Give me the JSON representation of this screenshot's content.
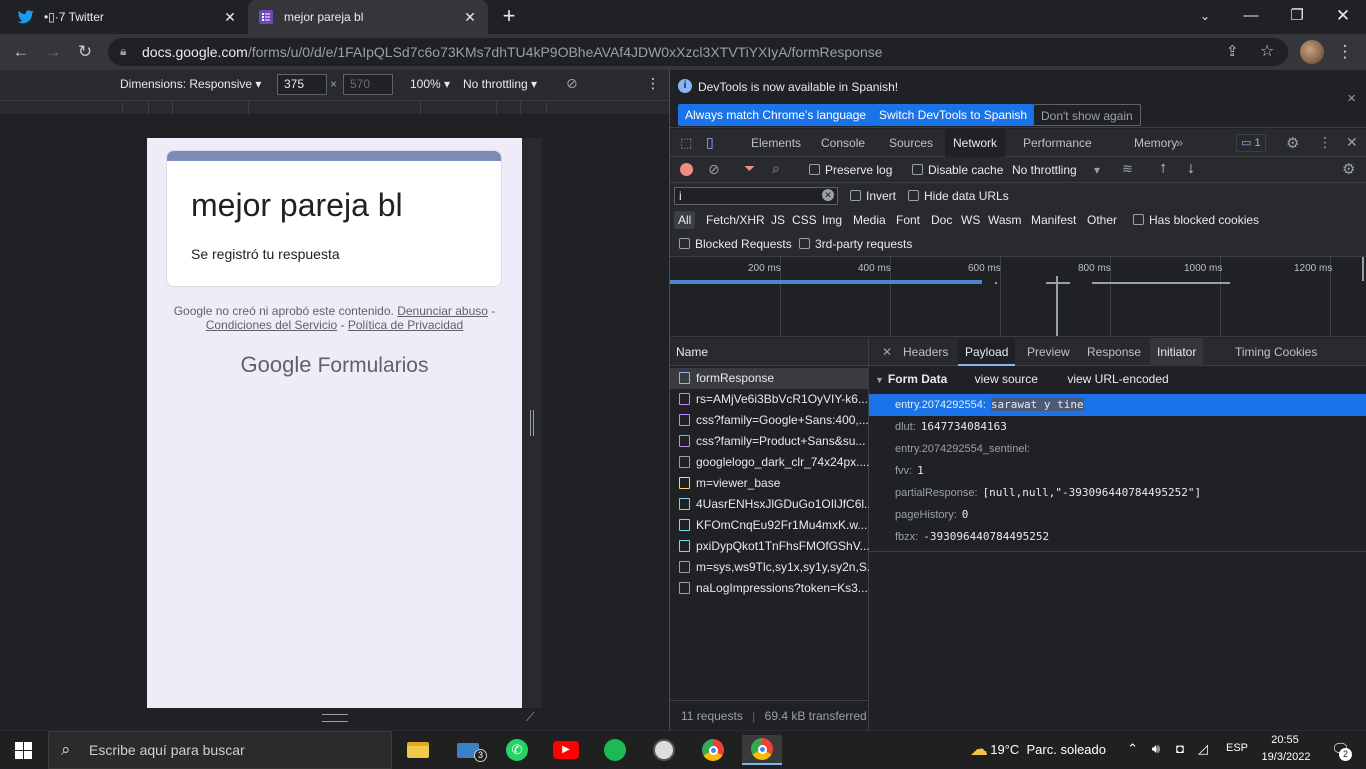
{
  "browser": {
    "tabs": [
      {
        "title": "•⁠▯⁠·⁠7 Twitter",
        "icon": "twitter-icon"
      },
      {
        "title": "mejor pareja bl",
        "icon": "google-forms-icon"
      }
    ],
    "url_host": "docs.google.com",
    "url_path": "/forms/u/0/d/e/1FAIpQLSd7c6o73KMs7dhTU4kP9OBheAVAf4JDW0xXzcl3XTVTiYXIyA/formResponse"
  },
  "device_toolbar": {
    "dimensions": "Dimensions: Responsive",
    "width": "375",
    "height": "570",
    "zoom": "100%",
    "throttling": "No throttling"
  },
  "form_page": {
    "title": "mejor pareja bl",
    "message": "Se registró tu respuesta",
    "disclaimer_text": "Google no creó ni aprobó este contenido.",
    "report_link": "Denunciar abuso",
    "terms_link": "Condiciones del Servicio",
    "privacy_link": "Política de Privacidad",
    "brand_google": "Google",
    "brand_product": "Formularios"
  },
  "devtools": {
    "infobar": {
      "message": "DevTools is now available in Spanish!",
      "btn_match": "Always match Chrome's language",
      "btn_switch": "Switch DevTools to Spanish",
      "btn_dismiss": "Don't show again"
    },
    "tabs": [
      "Elements",
      "Console",
      "Sources",
      "Network",
      "Performance",
      "Memory"
    ],
    "issues_count": "1",
    "network_bar": {
      "preserve_log": "Preserve log",
      "disable_cache": "Disable cache",
      "throttling": "No throttling"
    },
    "filter": {
      "value": "i",
      "invert": "Invert",
      "hide_data_urls": "Hide data URLs",
      "types": [
        "All",
        "Fetch/XHR",
        "JS",
        "CSS",
        "Img",
        "Media",
        "Font",
        "Doc",
        "WS",
        "Wasm",
        "Manifest",
        "Other"
      ],
      "has_blocked_cookies": "Has blocked cookies",
      "blocked_requests": "Blocked Requests",
      "third_party": "3rd-party requests"
    },
    "timeline_labels": [
      "200 ms",
      "400 ms",
      "600 ms",
      "800 ms",
      "1000 ms",
      "1200 ms"
    ],
    "requests_header": "Name",
    "requests": [
      {
        "name": "formResponse",
        "color": "#8ab4f8"
      },
      {
        "name": "rs=AMjVe6i3BbVcR1OyVIY-k6...",
        "color": "#c58af9"
      },
      {
        "name": "css?family=Google+Sans:400,...",
        "color": "#c58af9"
      },
      {
        "name": "css?family=Product+Sans&su...",
        "color": "#c58af9"
      },
      {
        "name": "googlelogo_dark_clr_74x24px....",
        "color": "#9aa0a6"
      },
      {
        "name": "m=viewer_base",
        "color": "#fdd663"
      },
      {
        "name": "4UasrENHsxJlGDuGo1OIlJfC6l...",
        "color": "#78d9ec"
      },
      {
        "name": "KFOmCnqEu92Fr1Mu4mxK.w...",
        "color": "#78d9ec"
      },
      {
        "name": "pxiDypQkot1TnFhsFMOfGShV...",
        "color": "#78d9ec"
      },
      {
        "name": "m=sys,ws9Tlc,sy1x,sy1y,sy2n,S...",
        "color": "#9aa0a6"
      },
      {
        "name": "naLogImpressions?token=Ks3...",
        "color": "#9aa0a6"
      }
    ],
    "requests_footer_count": "11 requests",
    "requests_footer_transfer": "69.4 kB transferred",
    "detail_tabs": [
      "Headers",
      "Payload",
      "Preview",
      "Response",
      "Initiator",
      "Timing",
      "Cookies"
    ],
    "form_data_label": "Form Data",
    "view_source": "view source",
    "view_url_encoded": "view URL-encoded",
    "form_data": [
      {
        "key": "entry.2074292554:",
        "value": "sarawat y tine"
      },
      {
        "key": "dlut:",
        "value": "1647734084163"
      },
      {
        "key": "entry.2074292554_sentinel:",
        "value": ""
      },
      {
        "key": "fvv:",
        "value": "1"
      },
      {
        "key": "partialResponse:",
        "value": "[null,null,\"-393096440784495252\"]"
      },
      {
        "key": "pageHistory:",
        "value": "0"
      },
      {
        "key": "fbzx:",
        "value": "-393096440784495252"
      }
    ]
  },
  "taskbar": {
    "search_placeholder": "Escribe aquí para buscar",
    "mail_badge": "3",
    "weather": "19°C  Parc. soleado",
    "lang": "ESP",
    "time": "20:55",
    "date": "19/3/2022",
    "notifications": "2"
  }
}
